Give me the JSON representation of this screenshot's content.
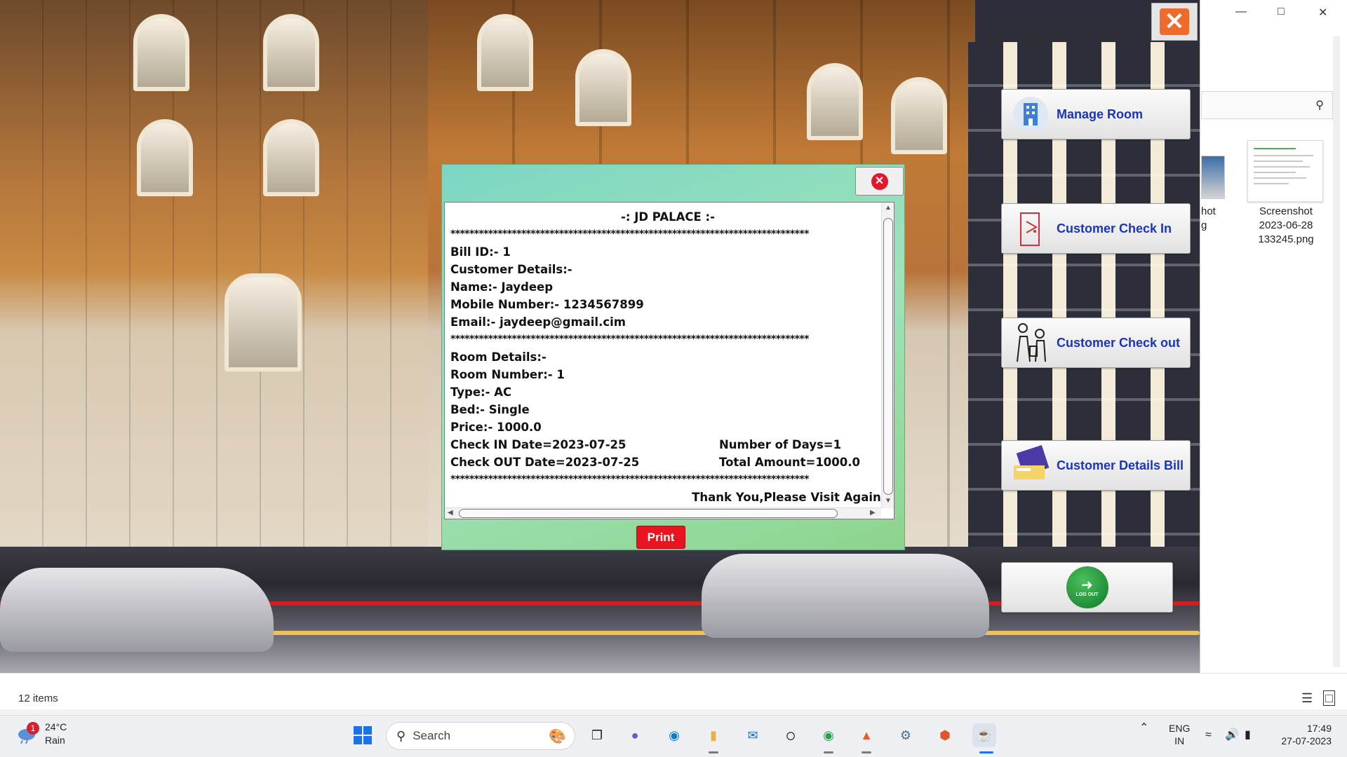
{
  "app": {
    "menu": [
      {
        "label": "Manage Room",
        "icon": "building-icon"
      },
      {
        "label": "Customer Check In",
        "icon": "door-icon"
      },
      {
        "label": "Customer Check out",
        "icon": "luggage-icon"
      },
      {
        "label": "Customer Details Bill",
        "icon": "bill-icon"
      },
      {
        "label": "LOG OUT",
        "icon": "logout-icon"
      }
    ],
    "close_icon": "close-icon"
  },
  "bill": {
    "title": "-: JD PALACE :-",
    "separator": "****************************************************************************",
    "bill_id": "Bill ID:- 1",
    "customer_heading": "Customer Details:-",
    "name": "Name:- Jaydeep",
    "mobile": "Mobile Number:- 1234567899",
    "email": "Email:- jaydeep@gmail.cim",
    "room_heading": "Room Details:-",
    "room_number": "Room Number:- 1",
    "type": "Type:- AC",
    "bed": "Bed:- Single",
    "price": "Price:- 1000.0",
    "check_in": "Check IN Date=2023-07-25",
    "days": "Number of Days=1",
    "check_out": "Check OUT Date=2023-07-25",
    "total": "Total Amount=1000.0",
    "thanks": "Thank You,Please Visit Again.",
    "print_label": "Print"
  },
  "explorer": {
    "partial_label_1": "hot",
    "partial_label_2": "g",
    "file_label_1": "Screenshot",
    "file_label_2": "2023-06-28",
    "file_label_3": "133245.png",
    "items_count": "12 items"
  },
  "taskbar": {
    "weather_badge": "1",
    "temperature": "24°C",
    "condition": "Rain",
    "search_label": "Search",
    "lang": "ENG",
    "region": "IN",
    "time": "17:49",
    "date": "27-07-2023"
  },
  "colors": {
    "menu_text": "#1a35b8",
    "print_button": "#e8141f",
    "dialog_gradient_start": "#7cd6c3",
    "dialog_gradient_end": "#8ed48e"
  }
}
